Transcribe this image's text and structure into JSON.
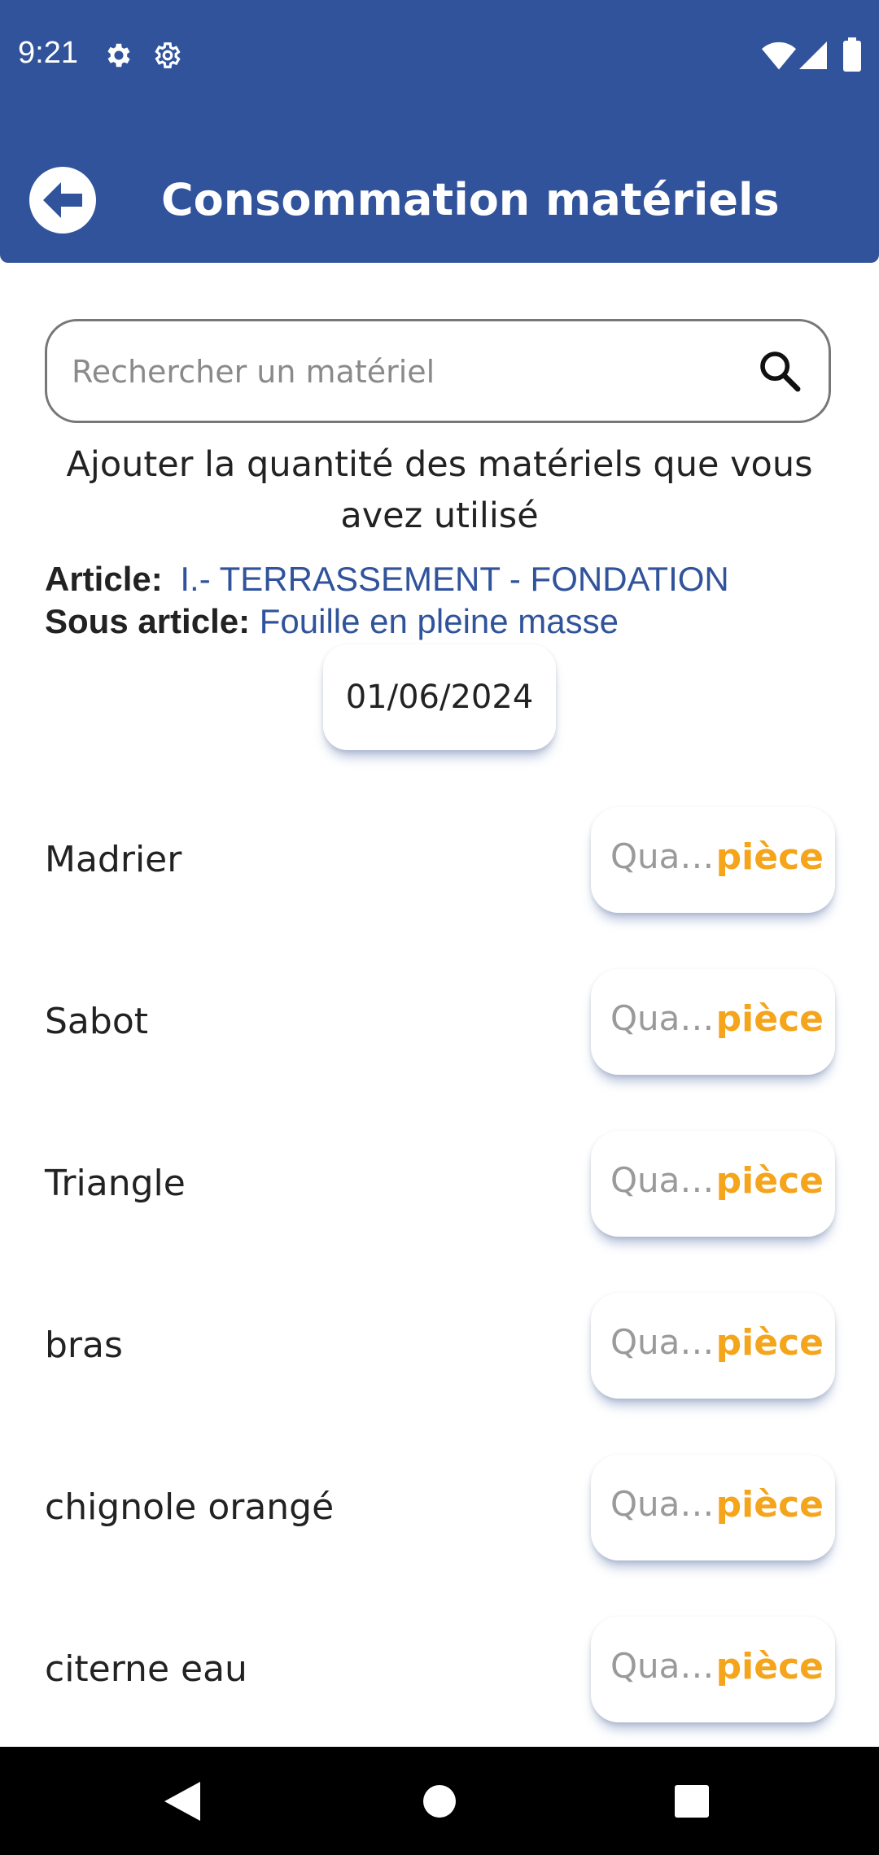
{
  "status_bar": {
    "time": "9:21",
    "icons": [
      "gear-icon",
      "settings-icon",
      "wifi-icon",
      "signal-icon",
      "battery-icon"
    ]
  },
  "header": {
    "title": "Consommation matériels",
    "back_icon": "arrow-left-icon",
    "background_color": "#30539b"
  },
  "search": {
    "placeholder": "Rechercher un matériel",
    "icon": "search-icon"
  },
  "instructions": "Ajouter la quantité des matériels que vous avez utilisé",
  "article": {
    "label": "Article:",
    "value": "I.- TERRASSEMENT - FONDATION"
  },
  "sous_article": {
    "label": "Sous article:",
    "value": "Fouille en pleine masse"
  },
  "date": "01/06/2024",
  "materials": [
    {
      "name": "Madrier",
      "quantity_placeholder": "Qua…",
      "unit": "pièce"
    },
    {
      "name": "Sabot",
      "quantity_placeholder": "Qua…",
      "unit": "pièce"
    },
    {
      "name": "Triangle",
      "quantity_placeholder": "Qua…",
      "unit": "pièce"
    },
    {
      "name": "bras",
      "quantity_placeholder": "Qua…",
      "unit": "pièce"
    },
    {
      "name": "chignole orangé",
      "quantity_placeholder": "Qua…",
      "unit": "pièce"
    },
    {
      "name": "citerne eau",
      "quantity_placeholder": "Qua…",
      "unit": "pièce"
    }
  ],
  "colors": {
    "accent": "#30539b",
    "unit": "#f4a51c"
  },
  "nav_bar": {
    "icons": [
      "back-triangle-icon",
      "home-circle-icon",
      "recents-square-icon"
    ]
  }
}
